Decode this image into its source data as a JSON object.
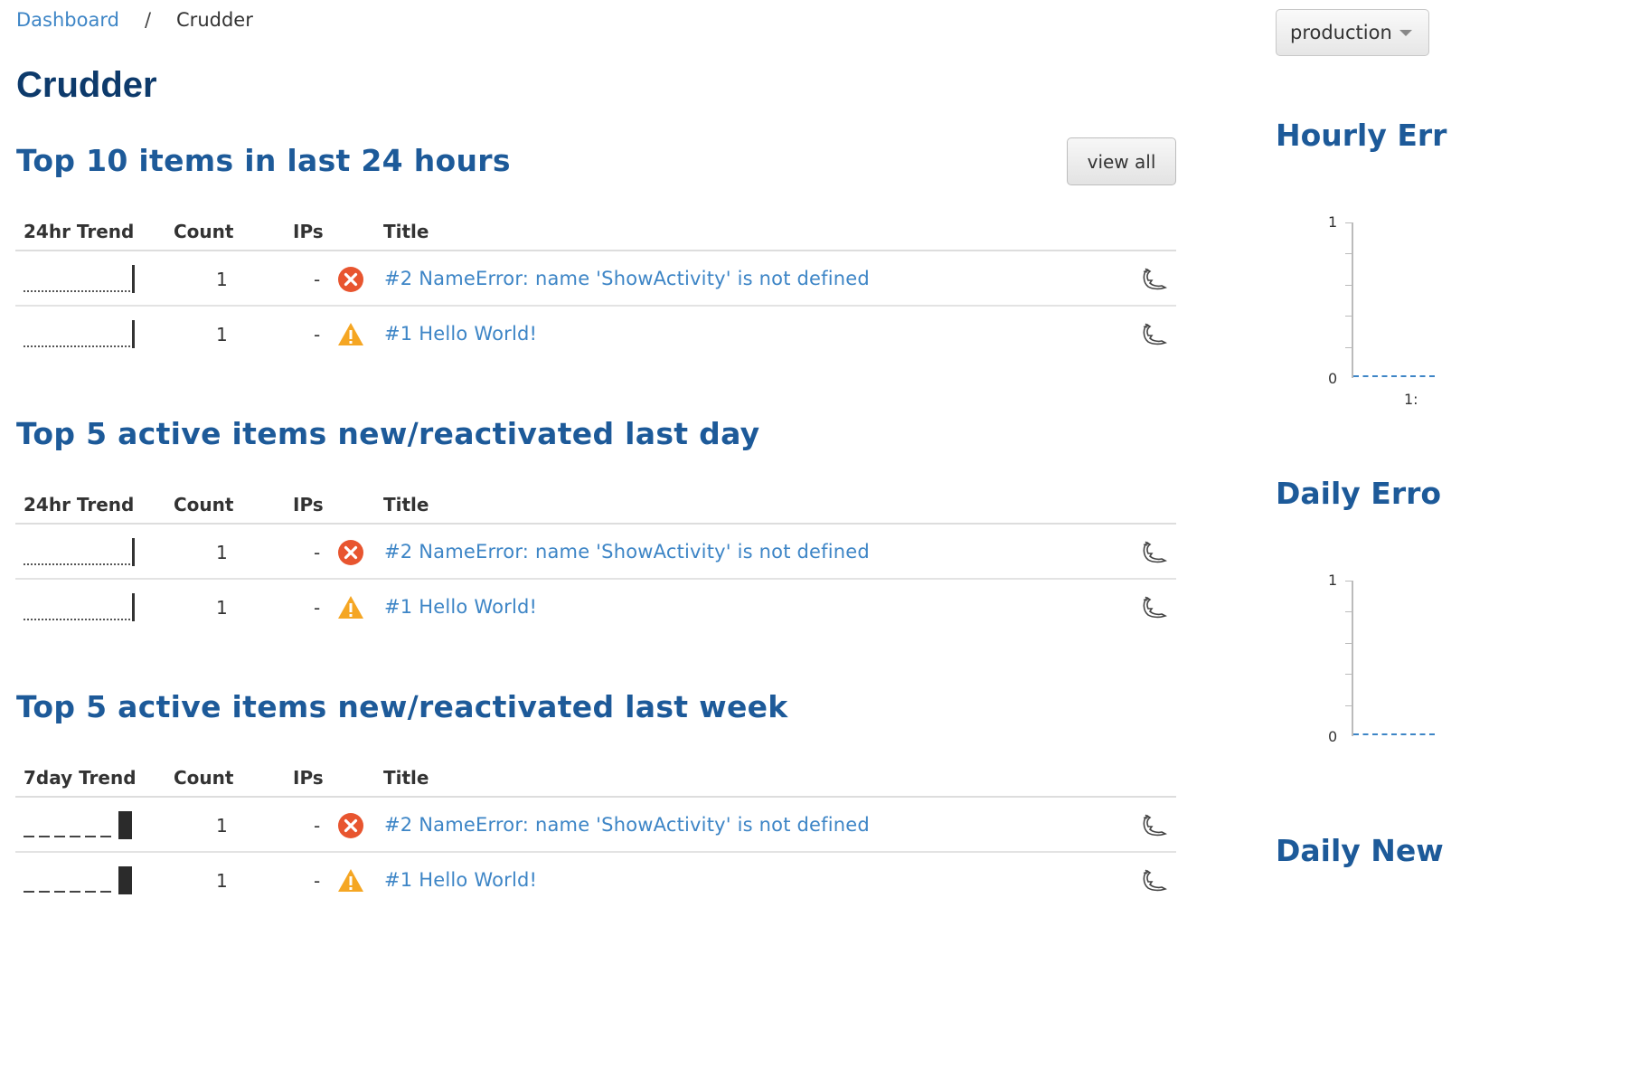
{
  "breadcrumb": {
    "root": "Dashboard",
    "separator": "/",
    "current": "Crudder"
  },
  "page": {
    "title": "Crudder"
  },
  "sections": [
    {
      "title": "Top 10 items in last 24 hours",
      "view_all_label": "view all",
      "headers": {
        "trend": "24hr Trend",
        "count": "Count",
        "ips": "IPs",
        "title": "Title"
      },
      "rows": [
        {
          "count": "1",
          "ips": "-",
          "level": "error-icon",
          "title": "#2 NameError: name 'ShowActivity' is not defined",
          "lang": "python-icon"
        },
        {
          "count": "1",
          "ips": "-",
          "level": "warning-icon",
          "title": "#1 Hello World!",
          "lang": "python-icon"
        }
      ]
    },
    {
      "title": "Top 5 active items new/reactivated last day",
      "headers": {
        "trend": "24hr Trend",
        "count": "Count",
        "ips": "IPs",
        "title": "Title"
      },
      "rows": [
        {
          "count": "1",
          "ips": "-",
          "level": "error-icon",
          "title": "#2 NameError: name 'ShowActivity' is not defined",
          "lang": "python-icon"
        },
        {
          "count": "1",
          "ips": "-",
          "level": "warning-icon",
          "title": "#1 Hello World!",
          "lang": "python-icon"
        }
      ]
    },
    {
      "title": "Top 5 active items new/reactivated last week",
      "headers": {
        "trend": "7day Trend",
        "count": "Count",
        "ips": "IPs",
        "title": "Title"
      },
      "rows": [
        {
          "count": "1",
          "ips": "-",
          "level": "error-icon",
          "title": "#2 NameError: name 'ShowActivity' is not defined",
          "lang": "python-icon"
        },
        {
          "count": "1",
          "ips": "-",
          "level": "warning-icon",
          "title": "#1 Hello World!",
          "lang": "python-icon"
        }
      ]
    }
  ],
  "sidebar": {
    "environment": "production",
    "charts": [
      {
        "title": "Hourly Err",
        "y_max": "1",
        "y_min": "0",
        "x_label": "1:"
      },
      {
        "title": "Daily Erro",
        "y_max": "1",
        "y_min": "0"
      },
      {
        "title": "Daily New"
      }
    ]
  },
  "colors": {
    "link": "#3d85c6",
    "heading": "#1d5a99",
    "title": "#0d3a6b",
    "error": "#e8552f",
    "warning": "#f5a623"
  }
}
